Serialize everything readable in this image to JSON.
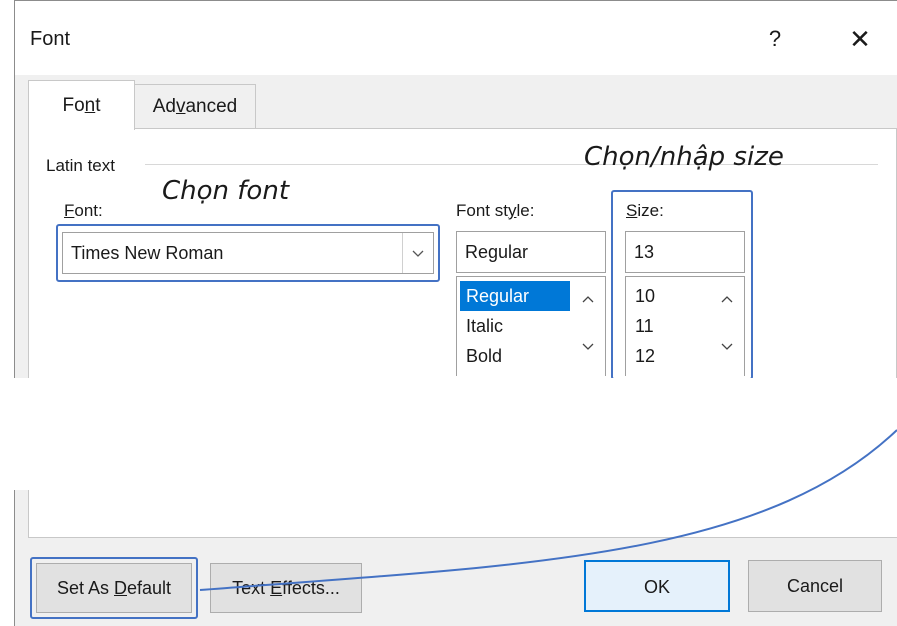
{
  "window": {
    "title": "Font",
    "help_label": "?",
    "close_label": "✕"
  },
  "tabs": [
    {
      "label_pre": "Fo",
      "label_u": "n",
      "label_post": "t",
      "active": true
    },
    {
      "label_pre": "Ad",
      "label_u": "v",
      "label_post": "anced",
      "active": false
    }
  ],
  "group": {
    "label": "Latin text"
  },
  "font_field": {
    "label_u": "F",
    "label_post": "ont:",
    "value": "Times New Roman",
    "dropdown_icon": "chevron-down-icon"
  },
  "style_field": {
    "label_pre": "Font st",
    "label_u": "y",
    "label_post": "le:",
    "value": "Regular",
    "options": [
      "Regular",
      "Italic",
      "Bold"
    ],
    "selected": "Regular"
  },
  "size_field": {
    "label_u": "S",
    "label_post": "ize:",
    "value": "13",
    "options": [
      "10",
      "11",
      "12"
    ]
  },
  "annotations": {
    "font": "Chọn font",
    "size": "Chọn/nhập size",
    "highlight_color": "#4472c4"
  },
  "buttons": {
    "set_default_pre": "Set As ",
    "set_default_u": "D",
    "set_default_post": "efault",
    "text_effects_pre": "Text ",
    "text_effects_u": "E",
    "text_effects_post": "ffects...",
    "ok": "OK",
    "cancel": "Cancel"
  },
  "colors": {
    "selection": "#0078d7",
    "dialog_bg": "#f0f0f0"
  }
}
